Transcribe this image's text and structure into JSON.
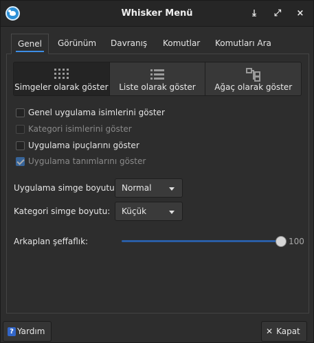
{
  "window": {
    "title": "Whisker Menü"
  },
  "titlebar_buttons": {
    "minimize": "⤓",
    "maximize": "⤢",
    "close": "×"
  },
  "tabs": [
    {
      "label": "Genel",
      "active": true
    },
    {
      "label": "Görünüm",
      "active": false
    },
    {
      "label": "Davranış",
      "active": false
    },
    {
      "label": "Komutlar",
      "active": false
    },
    {
      "label": "Komutları Ara",
      "active": false
    }
  ],
  "view_modes": [
    {
      "label": "Simgeler olarak göster",
      "icon": "grid-icon",
      "active": true
    },
    {
      "label": "Liste olarak göster",
      "icon": "list-icon",
      "active": false
    },
    {
      "label": "Ağaç olarak göster",
      "icon": "tree-icon",
      "active": false
    }
  ],
  "checkboxes": [
    {
      "label": "Genel uygulama isimlerini göster",
      "checked": false,
      "enabled": true
    },
    {
      "label": "Kategori isimlerini göster",
      "checked": false,
      "enabled": false
    },
    {
      "label": "Uygulama ipuçlarını göster",
      "checked": false,
      "enabled": true
    },
    {
      "label": "Uygulama tanımlarını göster",
      "checked": true,
      "enabled": false
    }
  ],
  "app_icon_size": {
    "label": "Uygulama simge boyutu:",
    "value": "Normal"
  },
  "category_icon_size": {
    "label": "Kategori simge boyutu:",
    "value": "Küçük"
  },
  "background_opacity": {
    "label": "Arkaplan şeffaflık:",
    "value": 100,
    "display": "100"
  },
  "footer": {
    "help_label": "Yardım",
    "close_label": "Kapat"
  },
  "colors": {
    "accent": "#3d8ee6",
    "background": "#2d2d2d",
    "titlebar": "#262626"
  }
}
